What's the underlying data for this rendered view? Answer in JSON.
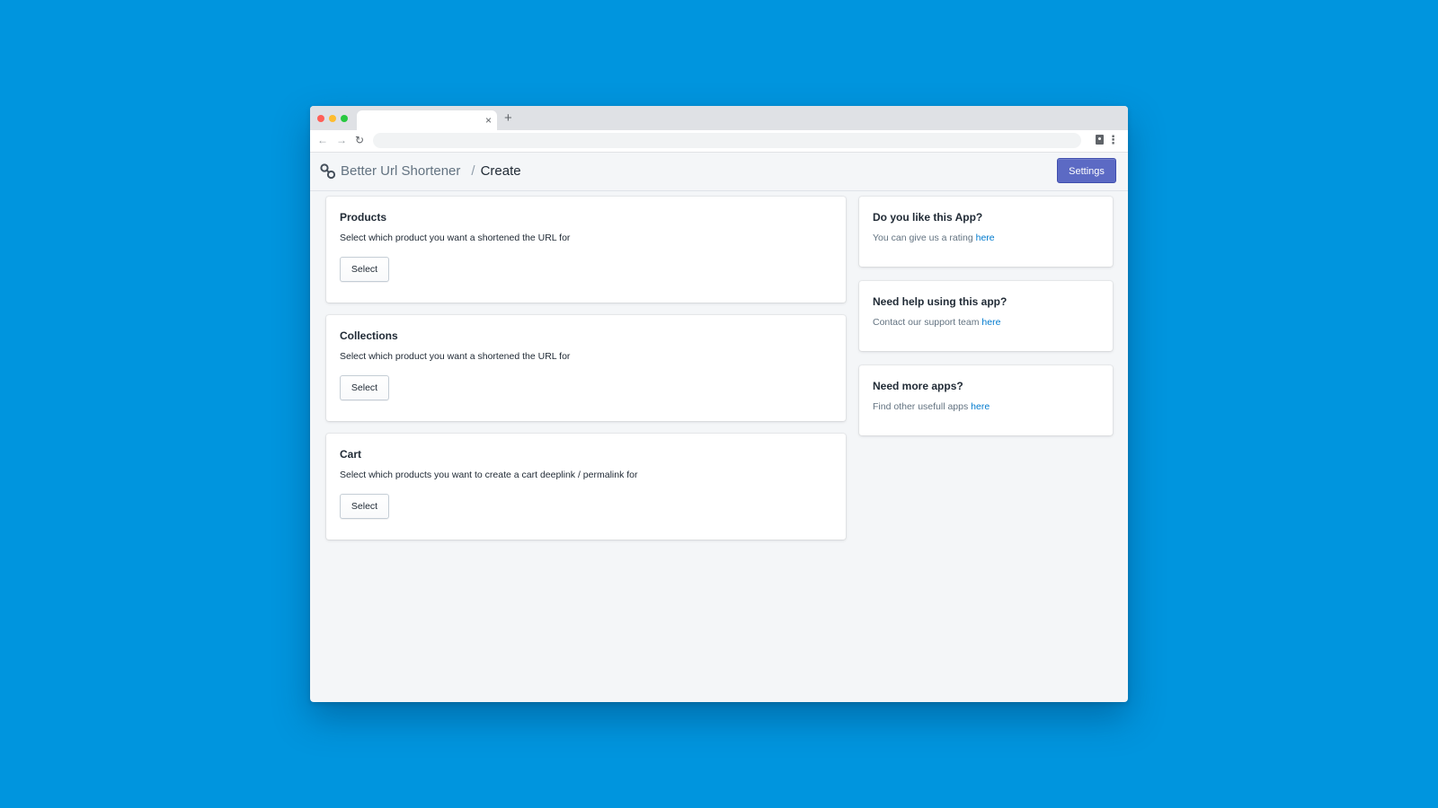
{
  "browser": {
    "tab_close_glyph": "×",
    "new_tab_glyph": "+",
    "back_glyph": "←",
    "forward_glyph": "→",
    "reload_glyph": "↻",
    "menu_glyph": "⋮"
  },
  "header": {
    "app_name": "Better Url Shortener",
    "separator": "/",
    "current_page": "Create",
    "settings_label": "Settings"
  },
  "main": {
    "cards": [
      {
        "title": "Products",
        "description": "Select which product you want a shortened the URL for",
        "button_label": "Select"
      },
      {
        "title": "Collections",
        "description": "Select which product you want a shortened the URL for",
        "button_label": "Select"
      },
      {
        "title": "Cart",
        "description": "Select which products you want to create a cart deeplink / permalink for",
        "button_label": "Select"
      }
    ]
  },
  "sidebar": {
    "cards": [
      {
        "title": "Do you like this App?",
        "text": "You can give us a rating ",
        "link_label": "here"
      },
      {
        "title": "Need help using this app?",
        "text": "Contact our support team ",
        "link_label": "here"
      },
      {
        "title": "Need more apps?",
        "text": "Find other usefull apps ",
        "link_label": "here"
      }
    ]
  },
  "colors": {
    "background": "#0095de",
    "primary_button": "#5c6ac4",
    "link": "#007ace"
  },
  "icons": {
    "breadcrumb_icon": "link-icon",
    "extension_icon": "clipboard-icon"
  }
}
